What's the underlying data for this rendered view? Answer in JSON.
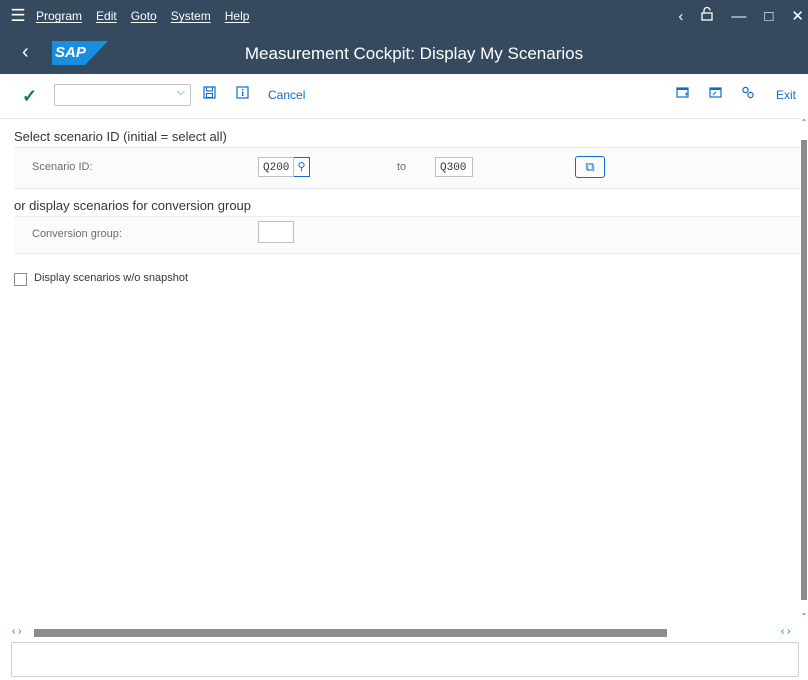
{
  "menu": {
    "items": [
      "Program",
      "Edit",
      "Goto",
      "System",
      "Help"
    ],
    "icons": [
      "chevron-left-icon",
      "unlock-icon",
      "minimize-icon",
      "maximize-icon",
      "close-icon"
    ]
  },
  "header": {
    "title": "Measurement Cockpit: Display My Scenarios",
    "logo_text": "SAP"
  },
  "toolbar": {
    "command_value": "",
    "cancel_label": "Cancel",
    "exit_label": "Exit"
  },
  "form": {
    "section1_title": "Select scenario ID (initial = select all)",
    "scenario_label": "Scenario ID:",
    "scenario_from": "Q200",
    "to_label": "to",
    "scenario_to": "Q300",
    "section2_title": "or display scenarios for conversion group",
    "conversion_label": "Conversion group:",
    "conversion_value": "",
    "checkbox_label": "Display scenarios w/o snapshot",
    "checkbox_checked": false
  },
  "colors": {
    "shell": "#354a5f",
    "accent": "#0a6ed1",
    "success": "#107e3e"
  },
  "status_text": ""
}
